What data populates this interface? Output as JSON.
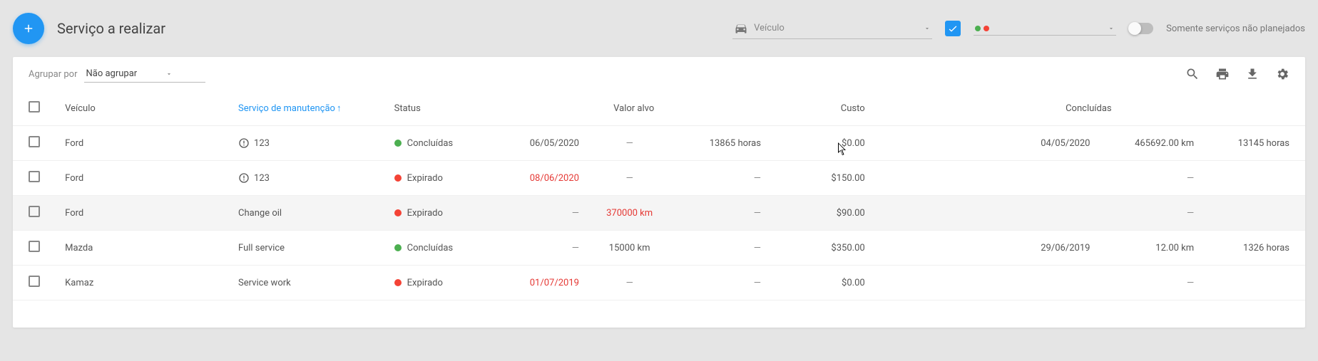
{
  "header": {
    "page_title": "Serviço a realizar",
    "vehicle_placeholder": "Veículo",
    "unplanned_label": "Somente serviços não planejados"
  },
  "toolbar": {
    "group_label": "Agrupar por",
    "group_value": "Não agrupar"
  },
  "columns": {
    "vehicle": "Veículo",
    "service": "Serviço de manutenção",
    "status": "Status",
    "target": "Valor alvo",
    "cost": "Custo",
    "completed": "Concluídas"
  },
  "status_labels": {
    "completed": "Concluídas",
    "expired": "Expirado"
  },
  "rows": [
    {
      "vehicle": "Ford",
      "service": "123",
      "service_icon": true,
      "status": "completed",
      "target_date": "06/05/2020",
      "target_date_red": false,
      "target_km": "",
      "target_km_red": false,
      "target_hrs": "13865 horas",
      "cost": "$0.00",
      "completed_date": "04/05/2020",
      "completed_km": "465692.00 km",
      "completed_hrs": "13145 horas",
      "highlight": false
    },
    {
      "vehicle": "Ford",
      "service": "123",
      "service_icon": true,
      "status": "expired",
      "target_date": "08/06/2020",
      "target_date_red": true,
      "target_km": "",
      "target_km_red": false,
      "target_hrs": "",
      "cost": "$150.00",
      "completed_date": "",
      "completed_km": "",
      "completed_hrs": "",
      "highlight": false
    },
    {
      "vehicle": "Ford",
      "service": "Change oil",
      "service_icon": false,
      "status": "expired",
      "target_date": "",
      "target_date_red": false,
      "target_km": "370000 km",
      "target_km_red": true,
      "target_hrs": "",
      "cost": "$90.00",
      "completed_date": "",
      "completed_km": "",
      "completed_hrs": "",
      "highlight": true
    },
    {
      "vehicle": "Mazda",
      "service": "Full service",
      "service_icon": false,
      "status": "completed",
      "target_date": "",
      "target_date_red": false,
      "target_km": "15000 km",
      "target_km_red": false,
      "target_hrs": "",
      "cost": "$350.00",
      "completed_date": "29/06/2019",
      "completed_km": "12.00 km",
      "completed_hrs": "1326 horas",
      "highlight": false
    },
    {
      "vehicle": "Kamaz",
      "service": "Service work",
      "service_icon": false,
      "status": "expired",
      "target_date": "01/07/2019",
      "target_date_red": true,
      "target_km": "",
      "target_km_red": false,
      "target_hrs": "",
      "cost": "$0.00",
      "completed_date": "",
      "completed_km": "",
      "completed_hrs": "",
      "highlight": false
    }
  ]
}
